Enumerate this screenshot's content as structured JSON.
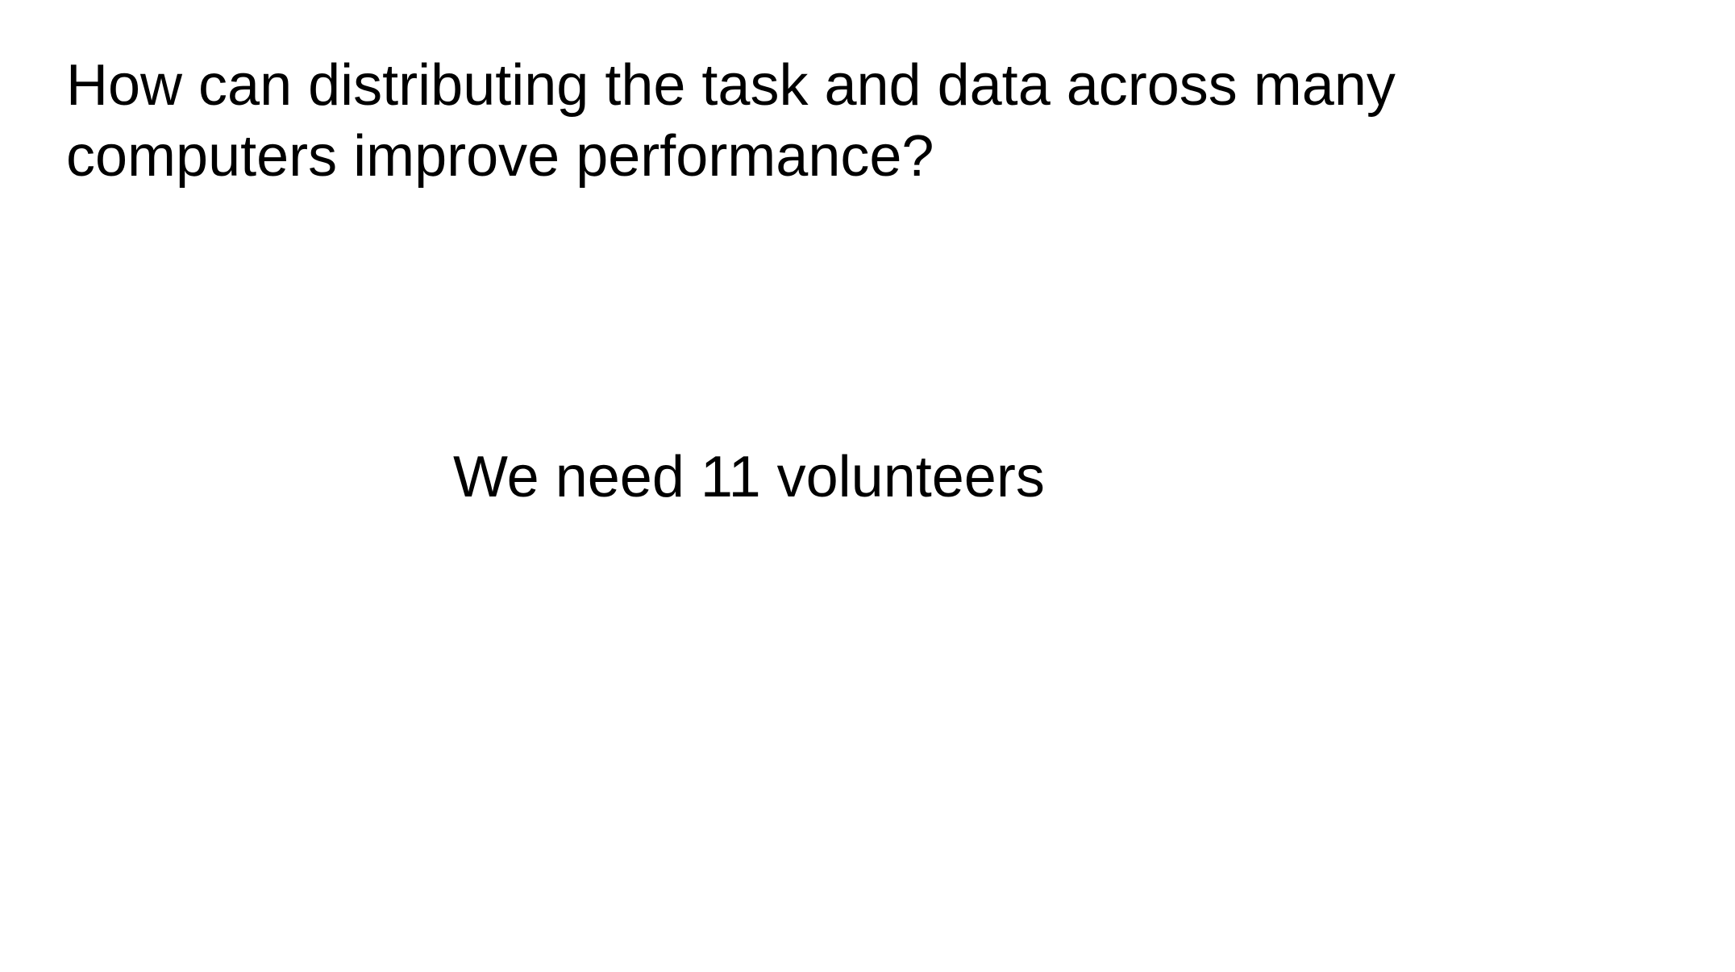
{
  "slide": {
    "title_lines": [
      "How can distributing the task and data across many",
      "computers improve performance?"
    ],
    "body_text": "We need 11 volunteers"
  },
  "colors": {
    "background": "#ffffff",
    "text": "#000000"
  }
}
